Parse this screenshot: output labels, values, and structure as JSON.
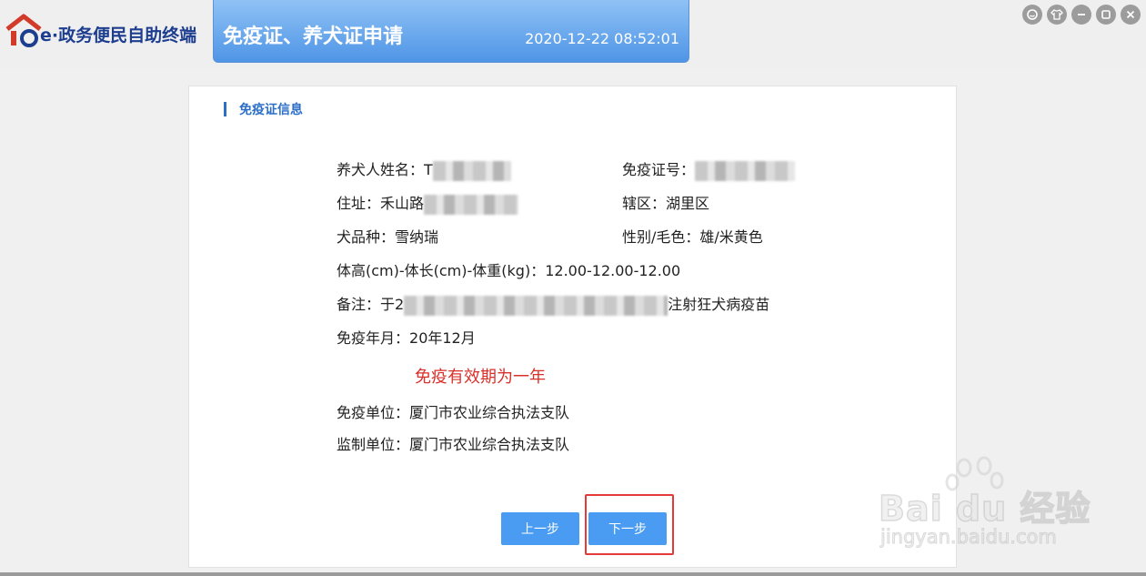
{
  "app": {
    "logo_text": "e·政务便民自助终端"
  },
  "header": {
    "title": "免疫证、养犬证申请",
    "datetime": "2020-12-22 08:52:01"
  },
  "section": {
    "title": "免疫证信息"
  },
  "fields": {
    "owner_label": "养犬人姓名：",
    "owner_value_visible": "T",
    "cert_label": "免疫证号：",
    "address_label": "住址：",
    "address_value_visible": "禾山路",
    "district_label": "辖区：",
    "district_value": "湖里区",
    "breed_label": "犬品种：",
    "breed_value": "雪纳瑞",
    "sex_color_label": "性别/毛色：",
    "sex_color_value": "雄/米黄色",
    "size_label": "体高(cm)-体长(cm)-体重(kg)：",
    "size_value": "12.00-12.00-12.00",
    "remark_label": "备注：",
    "remark_prefix": "于2",
    "remark_suffix": "注射狂犬病疫苗",
    "vacc_month_label": "免疫年月：",
    "vacc_month_value": "20年12月",
    "validity_text": "免疫有效期为一年",
    "vacc_unit_label": "免疫单位：",
    "vacc_unit_value": "厦门市农业综合执法支队",
    "supervise_label": "监制单位：",
    "supervise_value": "厦门市农业综合执法支队"
  },
  "buttons": {
    "prev": "上一步",
    "next": "下一步"
  },
  "watermark": {
    "brand": "Bai du 经验",
    "url": "jingyan.baidu.com"
  },
  "colors": {
    "accent_blue": "#4a9cf2",
    "title_gradient_top": "#8fc2f5",
    "alert_red": "#d9302a",
    "highlight_red": "#e53a3a"
  }
}
